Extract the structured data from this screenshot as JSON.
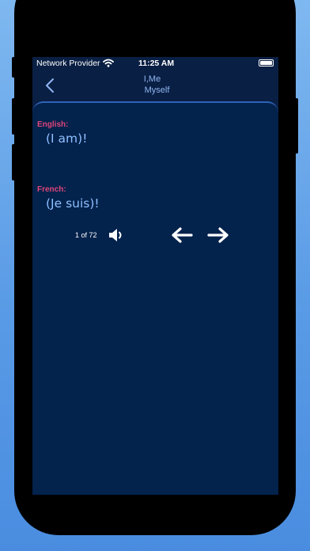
{
  "status_bar": {
    "provider": "Network Provider",
    "time": "11:25 AM",
    "wifi_icon": "wifi-icon",
    "battery_icon": "battery-icon"
  },
  "nav": {
    "back_icon": "chevron-left-icon",
    "title_line1": "I,Me",
    "title_line2": "Myself"
  },
  "card": {
    "source_language_label": "English:",
    "source_phrase": "(I am)!",
    "target_language_label": "French:",
    "target_phrase": "(Je suis)!",
    "counter": "1 of 72",
    "speaker_icon": "speaker-icon",
    "prev_icon": "arrow-left-icon",
    "next_icon": "arrow-right-icon"
  },
  "colors": {
    "screen_bg": "#0a1f44",
    "card_bg": "#03224c",
    "label_accent": "#e0457a",
    "phrase_text": "#8fc0ff",
    "title_text": "#8fb7f2"
  }
}
